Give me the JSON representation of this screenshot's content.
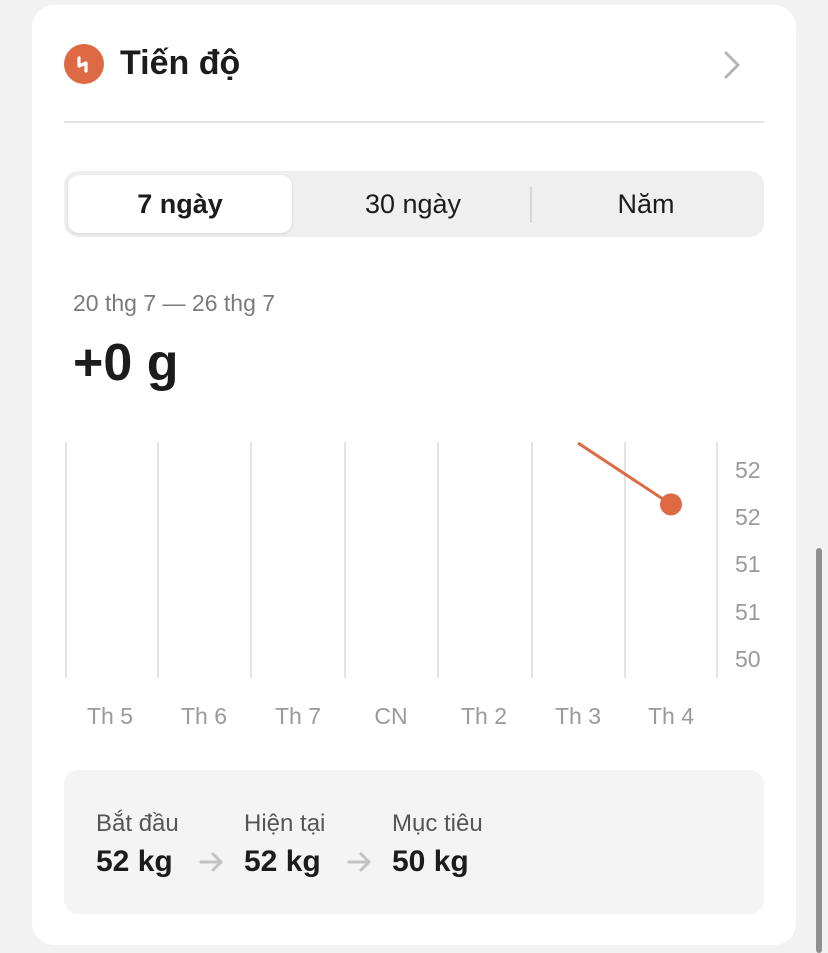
{
  "header": {
    "title": "Tiến độ",
    "icon": "progress-icon",
    "accent_color": "#de6a43"
  },
  "tabs": [
    {
      "label": "7 ngày",
      "active": true
    },
    {
      "label": "30 ngày",
      "active": false
    },
    {
      "label": "Năm",
      "active": false
    }
  ],
  "summary": {
    "date_range": "20 thg 7 — 26 thg 7",
    "change": "+0 g"
  },
  "chart_data": {
    "type": "line",
    "categories": [
      "Th 5",
      "Th 6",
      "Th 7",
      "CN",
      "Th 2",
      "Th 3",
      "Th 4"
    ],
    "y_tick_labels": [
      "52",
      "52",
      "51",
      "51",
      "50"
    ],
    "ylim": [
      50,
      52.5
    ],
    "series": [
      {
        "values": [
          null,
          null,
          null,
          null,
          null,
          52.8,
          52.0
        ],
        "color": "#de6a43"
      }
    ],
    "grid": "vertical",
    "axis_side": "right"
  },
  "stats": {
    "start": {
      "label": "Bắt đầu",
      "value": "52 kg"
    },
    "current": {
      "label": "Hiện tại",
      "value": "52 kg"
    },
    "goal": {
      "label": "Mục tiêu",
      "value": "50 kg"
    }
  }
}
